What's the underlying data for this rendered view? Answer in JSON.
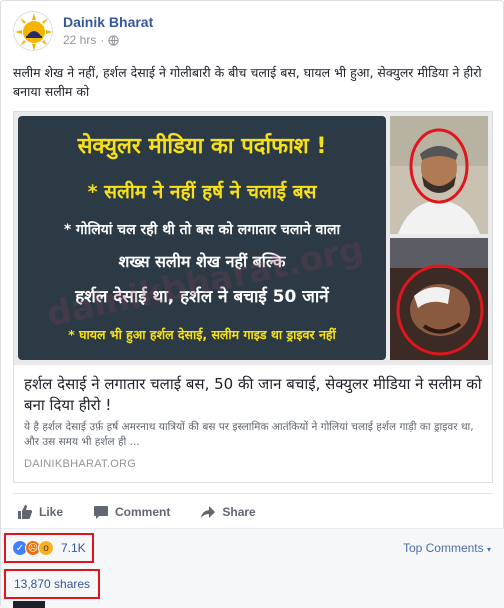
{
  "post": {
    "page_name": "Dainik Bharat",
    "time": "22 hrs",
    "separator": "·",
    "privacy_icon": "globe-icon",
    "caption": "सलीम शेख ने नहीं, हर्शल देसाई ने गोलीबारी के बीच चलाई बस, घायल भी हुआ, सेक्युलर मीडिया ने हीरो बनाया सलीम को"
  },
  "image": {
    "banner_title": "सेक्युलर मीडिया का पर्दाफाश !",
    "line1": "* सलीम ने नहीं हर्ष ने चलाई बस",
    "line2": "* गोलियां चल रही थी तो बस को लगातार चलाने वाला",
    "line3": "शख्स सलीम शेख नहीं बल्कि",
    "line4": "हर्शल देसाई था, हर्शल ने बचाई 50 जानें",
    "line5": "* घायल भी हुआ हर्शल देसाई, सलीम गाइड था ड्राइवर नहीं",
    "watermark": "dainikbharat.org"
  },
  "link": {
    "title": "हर्शल देसाई ने लगातार चलाई बस, 50 की जान बचाई, सेक्युलर मीडिया ने सलीम को बना दिया हीरो !",
    "description": "ये है हर्शल देसाई उर्फ़ हर्ष अमरनाथ यात्रियों की बस पर इस्लामिक आतंकियों ने गोलियां चलाई हर्शल गाड़ी का ड्राइवर था, और उस समय भी हर्शल ही ...",
    "domain": "DAINIKBHARAT.ORG"
  },
  "actions": {
    "like": "Like",
    "comment": "Comment",
    "share": "Share"
  },
  "stats": {
    "reaction_count": "7.1K",
    "top_comments": "Top Comments",
    "shares": "13,870 shares"
  },
  "colors": {
    "link_blue": "#365899",
    "highlight_red": "#e0161e",
    "banner_bg": "#2b3a45",
    "banner_yellow": "#f7e017"
  }
}
